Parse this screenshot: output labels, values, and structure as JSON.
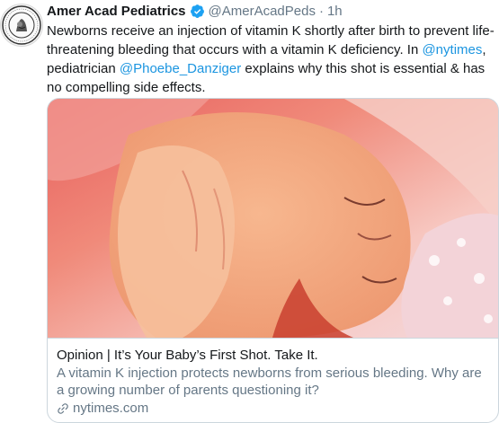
{
  "tweet": {
    "display_name": "Amer Acad Pediatrics",
    "handle": "@AmerAcadPeds",
    "separator": "·",
    "time": "1h",
    "text_before_1": "Newborns receive an injection of vitamin K shortly after birth to prevent life-threatening bleeding that occurs with a vitamin K deficiency. In ",
    "mention_1": "@nytimes",
    "text_between": ", pediatrician ",
    "mention_2": "@Phoebe_Danziger",
    "text_after": " explains why this shot is essential & has no compelling side effects.",
    "icons": {
      "verified": "verified-badge-icon",
      "link": "link-icon"
    },
    "colors": {
      "link": "#1b95e0",
      "verified": "#1da1f2",
      "secondary_text": "#657786"
    }
  },
  "card": {
    "title": "Opinion | It’s Your Baby’s First Shot. Take It.",
    "description": "A vitamin K injection protects newborns from serious bleeding. Why are a growing number of parents questioning it?",
    "domain": "nytimes.com"
  }
}
